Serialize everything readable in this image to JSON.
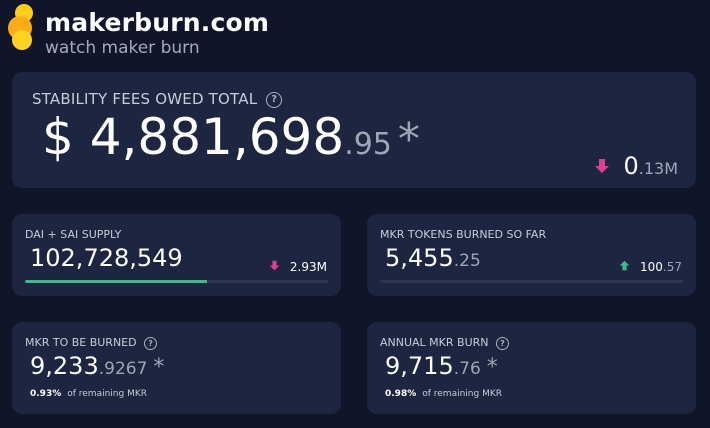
{
  "header": {
    "site_title": "makerburn.com",
    "tagline": "watch maker burn"
  },
  "stability": {
    "label": "STABILITY FEES OWED TOTAL",
    "value_int": "$ 4,881,698",
    "value_dec": ".95",
    "asterisk": "*",
    "change_int": "0",
    "change_dec": ".13M",
    "change_direction": "down"
  },
  "supply": {
    "label": "DAI + SAI SUPPLY",
    "value_int": "102,728,549",
    "change": "2.93M",
    "change_direction": "down",
    "progress_fraction": 0.6
  },
  "burned": {
    "label": "MKR TOKENS BURNED SO FAR",
    "value_int": "5,455",
    "value_dec": ".25",
    "change_int": "100",
    "change_dec": ".57",
    "change_direction": "up",
    "progress_fraction": 0.0
  },
  "to_be_burned": {
    "label": "MKR TO BE BURNED",
    "value_int": "9,233",
    "value_dec": ".9267",
    "asterisk": "*",
    "pct": "0.93%",
    "note": "of remaining MKR"
  },
  "annual": {
    "label": "ANNUAL MKR BURN",
    "value_int": "9,715",
    "value_dec": ".76",
    "asterisk": "*",
    "pct": "0.98%",
    "note": "of remaining MKR"
  },
  "colors": {
    "background": "#10152a",
    "card": "#1e2540",
    "down_arrow": "#e23d8f",
    "up_arrow": "#3fb890",
    "logo": "#ffb81c"
  },
  "icons": {
    "help": "question-circle-icon",
    "down": "arrow-down-icon",
    "up": "arrow-up-icon",
    "logo": "flame-bubbles-logo"
  }
}
